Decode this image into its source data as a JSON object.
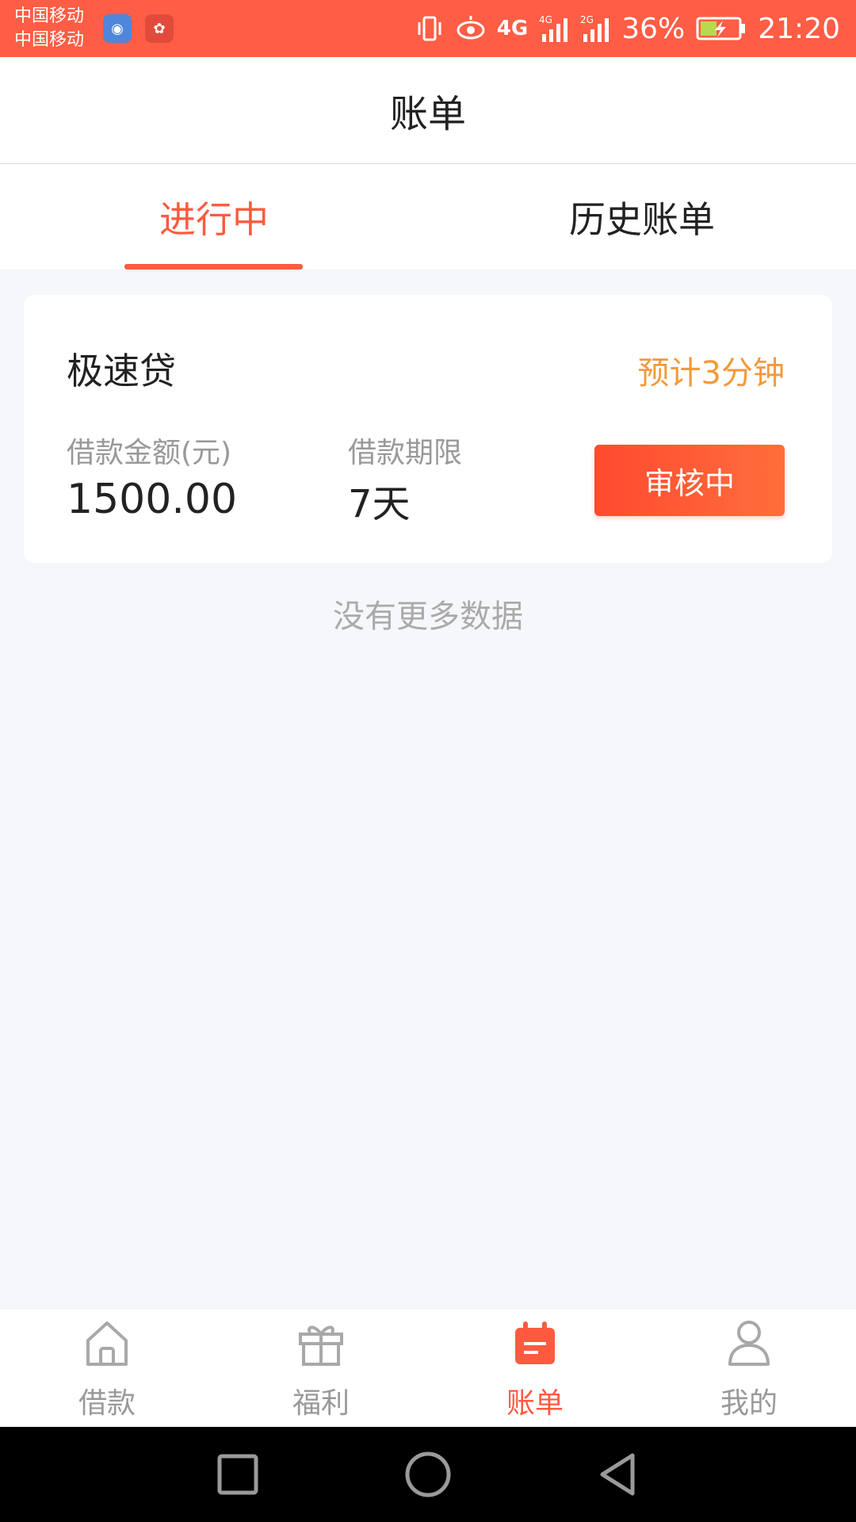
{
  "status_bar": {
    "carrier_1": "中国移动",
    "carrier_2": "中国移动",
    "network_1": "4G",
    "network_2": "4G",
    "network_3": "2G",
    "battery": "36%",
    "time": "21:20"
  },
  "header": {
    "title": "账单"
  },
  "tabs": [
    {
      "label": "进行中",
      "active": true
    },
    {
      "label": "历史账单",
      "active": false
    }
  ],
  "loan_card": {
    "product_name": "极速贷",
    "estimate": "预计3分钟",
    "amount_label": "借款金额(元)",
    "amount_value": "1500.00",
    "term_label": "借款期限",
    "term_value": "7天",
    "status_button": "审核中"
  },
  "list_footer": "没有更多数据",
  "bottom_nav": [
    {
      "label": "借款",
      "icon": "home-icon",
      "active": false
    },
    {
      "label": "福利",
      "icon": "gift-icon",
      "active": false
    },
    {
      "label": "账单",
      "icon": "bill-icon",
      "active": true
    },
    {
      "label": "我的",
      "icon": "user-icon",
      "active": false
    }
  ],
  "colors": {
    "status_bar": "#ff5d45",
    "accent": "#ff5a40",
    "estimate": "#f29a3a",
    "background": "#f6f7fb"
  }
}
